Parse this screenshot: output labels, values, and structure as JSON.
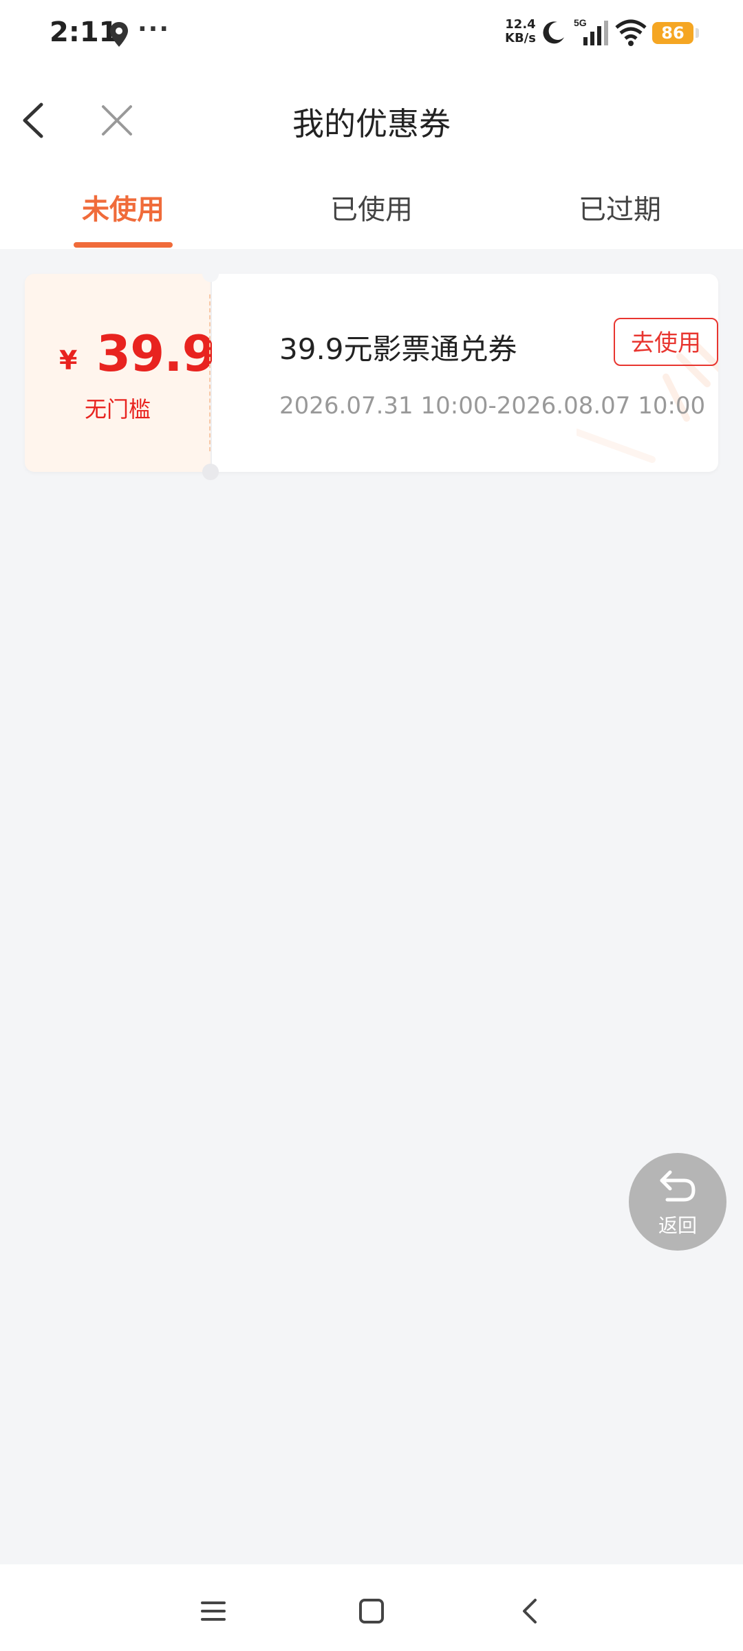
{
  "status_bar": {
    "time": "2:11",
    "dots": "···",
    "net_speed_value": "12.4",
    "net_speed_unit": "KB/s",
    "network_type": "5G",
    "battery": "86"
  },
  "header": {
    "title": "我的优惠券"
  },
  "tabs": [
    {
      "label": "未使用",
      "active": true
    },
    {
      "label": "已使用",
      "active": false
    },
    {
      "label": "已过期",
      "active": false
    }
  ],
  "coupon": {
    "currency": "¥",
    "amount": "39.9",
    "threshold": "无门槛",
    "name": "39.9元影票通兑券",
    "validity": "2026.07.31 10:00-2026.08.07 10:00",
    "action_label": "去使用"
  },
  "float_back": {
    "label": "返回"
  },
  "colors": {
    "accent": "#f06b3a",
    "price_red": "#e8231f",
    "background": "#f4f5f7"
  }
}
